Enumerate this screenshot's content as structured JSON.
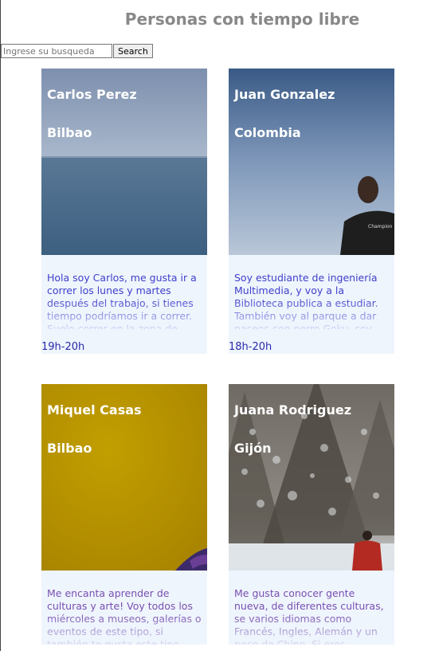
{
  "page": {
    "title": "Personas con tiempo libre"
  },
  "search": {
    "placeholder": "Ingrese su busqueda",
    "button_label": "Search"
  },
  "cards": [
    {
      "name": "Carlos Perez",
      "city": "Bilbao",
      "description": "Hola soy Carlos, me gusta ir a correr los lunes y martes después del trabajo, si tienes tiempo podríamos ir a correr. Suelo correr en la zona de",
      "time": "19h-20h"
    },
    {
      "name": "Juan Gonzalez",
      "city": "Colombia",
      "description": "Soy estudiante de ingeniería Multimedia, y voy a la Biblioteca publica a estudiar. También voy al parque a dar paseos con perro Goku, soy",
      "time": "18h-20h"
    },
    {
      "name": "Miquel Casas",
      "city": "Bilbao",
      "description": "Me encanta aprender de culturas y arte! Voy todos los miércoles a museos, galerías o eventos de este tipo, si también te gusta este tipo",
      "time": ""
    },
    {
      "name": "Juana Rodriguez",
      "city": "Gijón",
      "description": "Me gusta conocer gente nueva, de diferentes culturas, se varios idiomas como Francés, Ingles, Alemán y un poco de Chino. Si eres",
      "time": ""
    }
  ]
}
